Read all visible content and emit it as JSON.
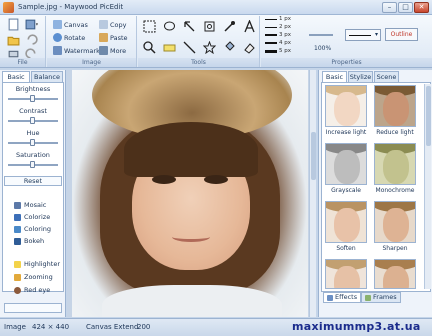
{
  "window": {
    "title": "Sample.jpg - Maywood PicEdit",
    "min": "–",
    "max": "□",
    "close": "✕"
  },
  "ribbon": {
    "file": {
      "label": "File"
    },
    "image": {
      "label": "Image",
      "canvas": "Canvas",
      "copy": "Copy",
      "rotate": "Rotate",
      "paste": "Paste",
      "watermark": "Watermark",
      "more": "More"
    },
    "tools": {
      "label": "Tools"
    },
    "properties": {
      "label": "Properties",
      "line_widths": [
        "1 px",
        "2 px",
        "3 px",
        "4 px",
        "5 px"
      ],
      "zoom": "100%",
      "outline": "Outline"
    }
  },
  "left_panel": {
    "tabs": [
      "Basic",
      "Balance"
    ],
    "adjustments": [
      "Brightness",
      "Contrast",
      "Hue",
      "Saturation"
    ],
    "slider_levels": [
      0.5,
      0.5,
      0.5,
      0.5
    ],
    "reset": "Reset",
    "effects": [
      "Mosaic",
      "Colorize",
      "Coloring",
      "Bokeh"
    ],
    "tools": [
      "Highlighter",
      "Zooming",
      "Red eye"
    ]
  },
  "right_panel": {
    "tabs": [
      "Basic",
      "Stylize",
      "Scene"
    ],
    "thumbnails": [
      "Increase light",
      "Reduce light",
      "Grayscale",
      "Monochrome",
      "Soften",
      "Sharpen",
      "",
      ""
    ],
    "bottom_tabs": [
      "Effects",
      "Frames"
    ]
  },
  "status": {
    "image_label": "Image",
    "image_size": "424 × 440",
    "canvas_label": "Canvas Extend",
    "canvas_value": "200"
  },
  "watermark_text": "maximummp3.at.ua",
  "colors": {
    "ribbon": "#dce7f4",
    "panel": "#eef3fa",
    "accent": "#1a2b8c",
    "outline": "#c0392b"
  }
}
